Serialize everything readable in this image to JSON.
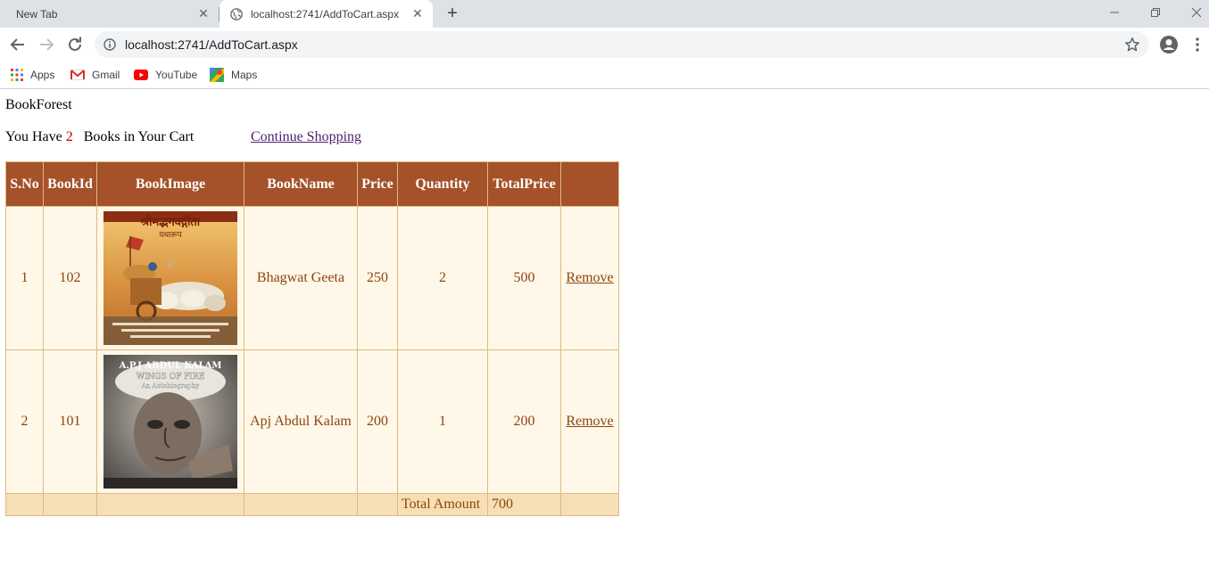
{
  "browser": {
    "tabs": [
      {
        "title": "New Tab",
        "active": false
      },
      {
        "title": "localhost:2741/AddToCart.aspx",
        "active": true
      }
    ],
    "url": "localhost:2741/AddToCart.aspx",
    "bookmarks": [
      "Apps",
      "Gmail",
      "YouTube",
      "Maps"
    ]
  },
  "page": {
    "brand": "BookForest",
    "cart_prefix": "You Have",
    "cart_count": "2",
    "cart_suffix": "Books in Your Cart",
    "continue_label": "Continue Shopping"
  },
  "table": {
    "headers": [
      "S.No",
      "BookId",
      "BookImage",
      "BookName",
      "Price",
      "Quantity",
      "TotalPrice",
      ""
    ],
    "rows": [
      {
        "sno": "1",
        "bookid": "102",
        "image": "bhagwat-geeta-cover",
        "image_title": "श्रीमद्भगवद्गीता",
        "image_subtitle": "यथारूप",
        "name": "Bhagwat Geeta",
        "price": "250",
        "quantity": "2",
        "total": "500",
        "action": "Remove"
      },
      {
        "sno": "2",
        "bookid": "101",
        "image": "wings-of-fire-cover",
        "image_title": "A.P.J ABDUL KALAM",
        "image_subtitle": "WINGS OF FIRE",
        "image_note": "An Autobiography",
        "name": "Apj Abdul Kalam",
        "price": "200",
        "quantity": "1",
        "total": "200",
        "action": "Remove"
      }
    ],
    "footer": {
      "label": "Total Amount",
      "value": "700"
    }
  },
  "colors": {
    "header_bg": "#a55129",
    "row_bg": "#fff7e7",
    "footer_bg": "#f7dfb5",
    "text": "#8c4510",
    "border": "#deba84",
    "count": "#cc0000"
  }
}
